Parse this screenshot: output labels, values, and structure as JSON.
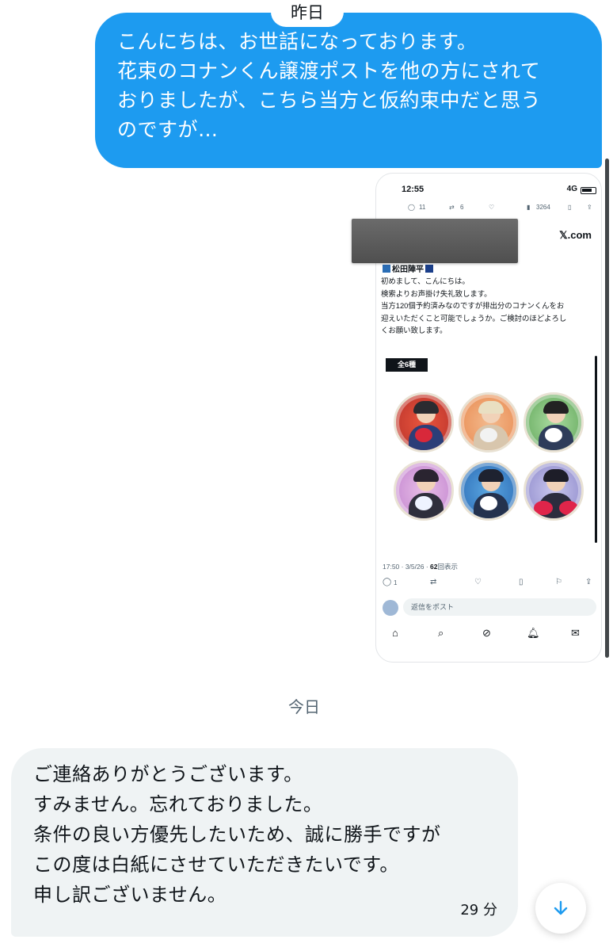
{
  "conversation": {
    "date_yesterday": "昨日",
    "date_today": "今日",
    "outgoing": {
      "lines": [
        "こんにちは、お世話になっております。",
        "花束のコナンくん譲渡ポストを他の方にされて",
        "おりましたが、こちら当方と仮約束中だと思う",
        "のですが…"
      ]
    },
    "incoming": {
      "lines": [
        "ご連絡ありがとうございます。",
        "すみません。忘れておりました。",
        "条件の良い方優先したいため、誠に勝手ですが",
        "この度は白紙にさせていただきたいです。",
        "申し訳ございません。"
      ],
      "time": "29 分"
    }
  },
  "attachment": {
    "status_time": "12:55",
    "network": "4G",
    "top_actions": {
      "replies": "11",
      "reposts": "6",
      "views": "3264"
    },
    "brand": "𝕏.com",
    "author": "松田陣平",
    "post_lines": [
      "初めまして、こんにちは。",
      "検索よりお声掛け失礼致します。",
      "当方120個予約済みなのですが排出分のコナンくんをお",
      "迎えいただくこと可能でしょうか。ご検討のほどよろし",
      "くお願い致します。"
    ],
    "tag": "全6種",
    "meta_time": "17:50 · 3/5/26 · ",
    "meta_views_num": "62",
    "meta_views_label": "回表示",
    "bottom_replies": "1",
    "reply_placeholder": "返信をポスト"
  },
  "colors": {
    "accent": "#1d9bf0",
    "incoming_bg": "#eff3f4",
    "redaction": "#5a5a5a"
  },
  "icons": [
    "chevron-down-icon",
    "reply-icon",
    "repost-icon",
    "like-icon",
    "views-icon",
    "bookmark-icon",
    "share-icon",
    "home-icon",
    "search-icon",
    "grok-icon",
    "notifications-icon",
    "messages-icon"
  ]
}
